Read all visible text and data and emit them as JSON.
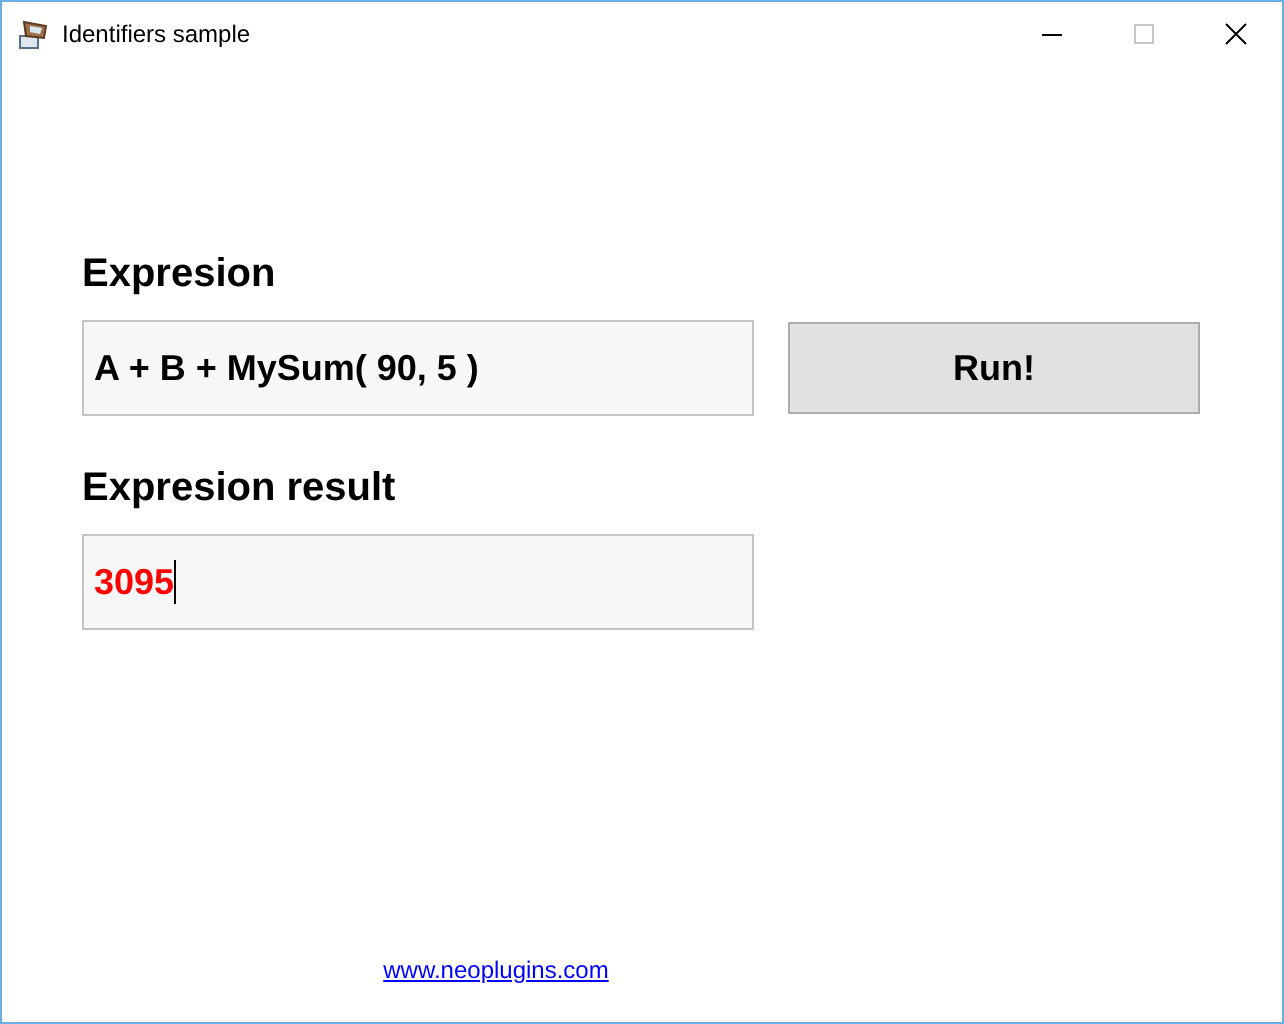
{
  "window": {
    "title": "Identifiers sample"
  },
  "expression": {
    "label": "Expresion",
    "value": "A + B + MySum( 90, 5 )"
  },
  "run_button": {
    "label": "Run!"
  },
  "result": {
    "label": "Expresion result",
    "value": "3095",
    "color": "#ff0000",
    "focused": true
  },
  "link": {
    "text": "www.neoplugins.com"
  }
}
